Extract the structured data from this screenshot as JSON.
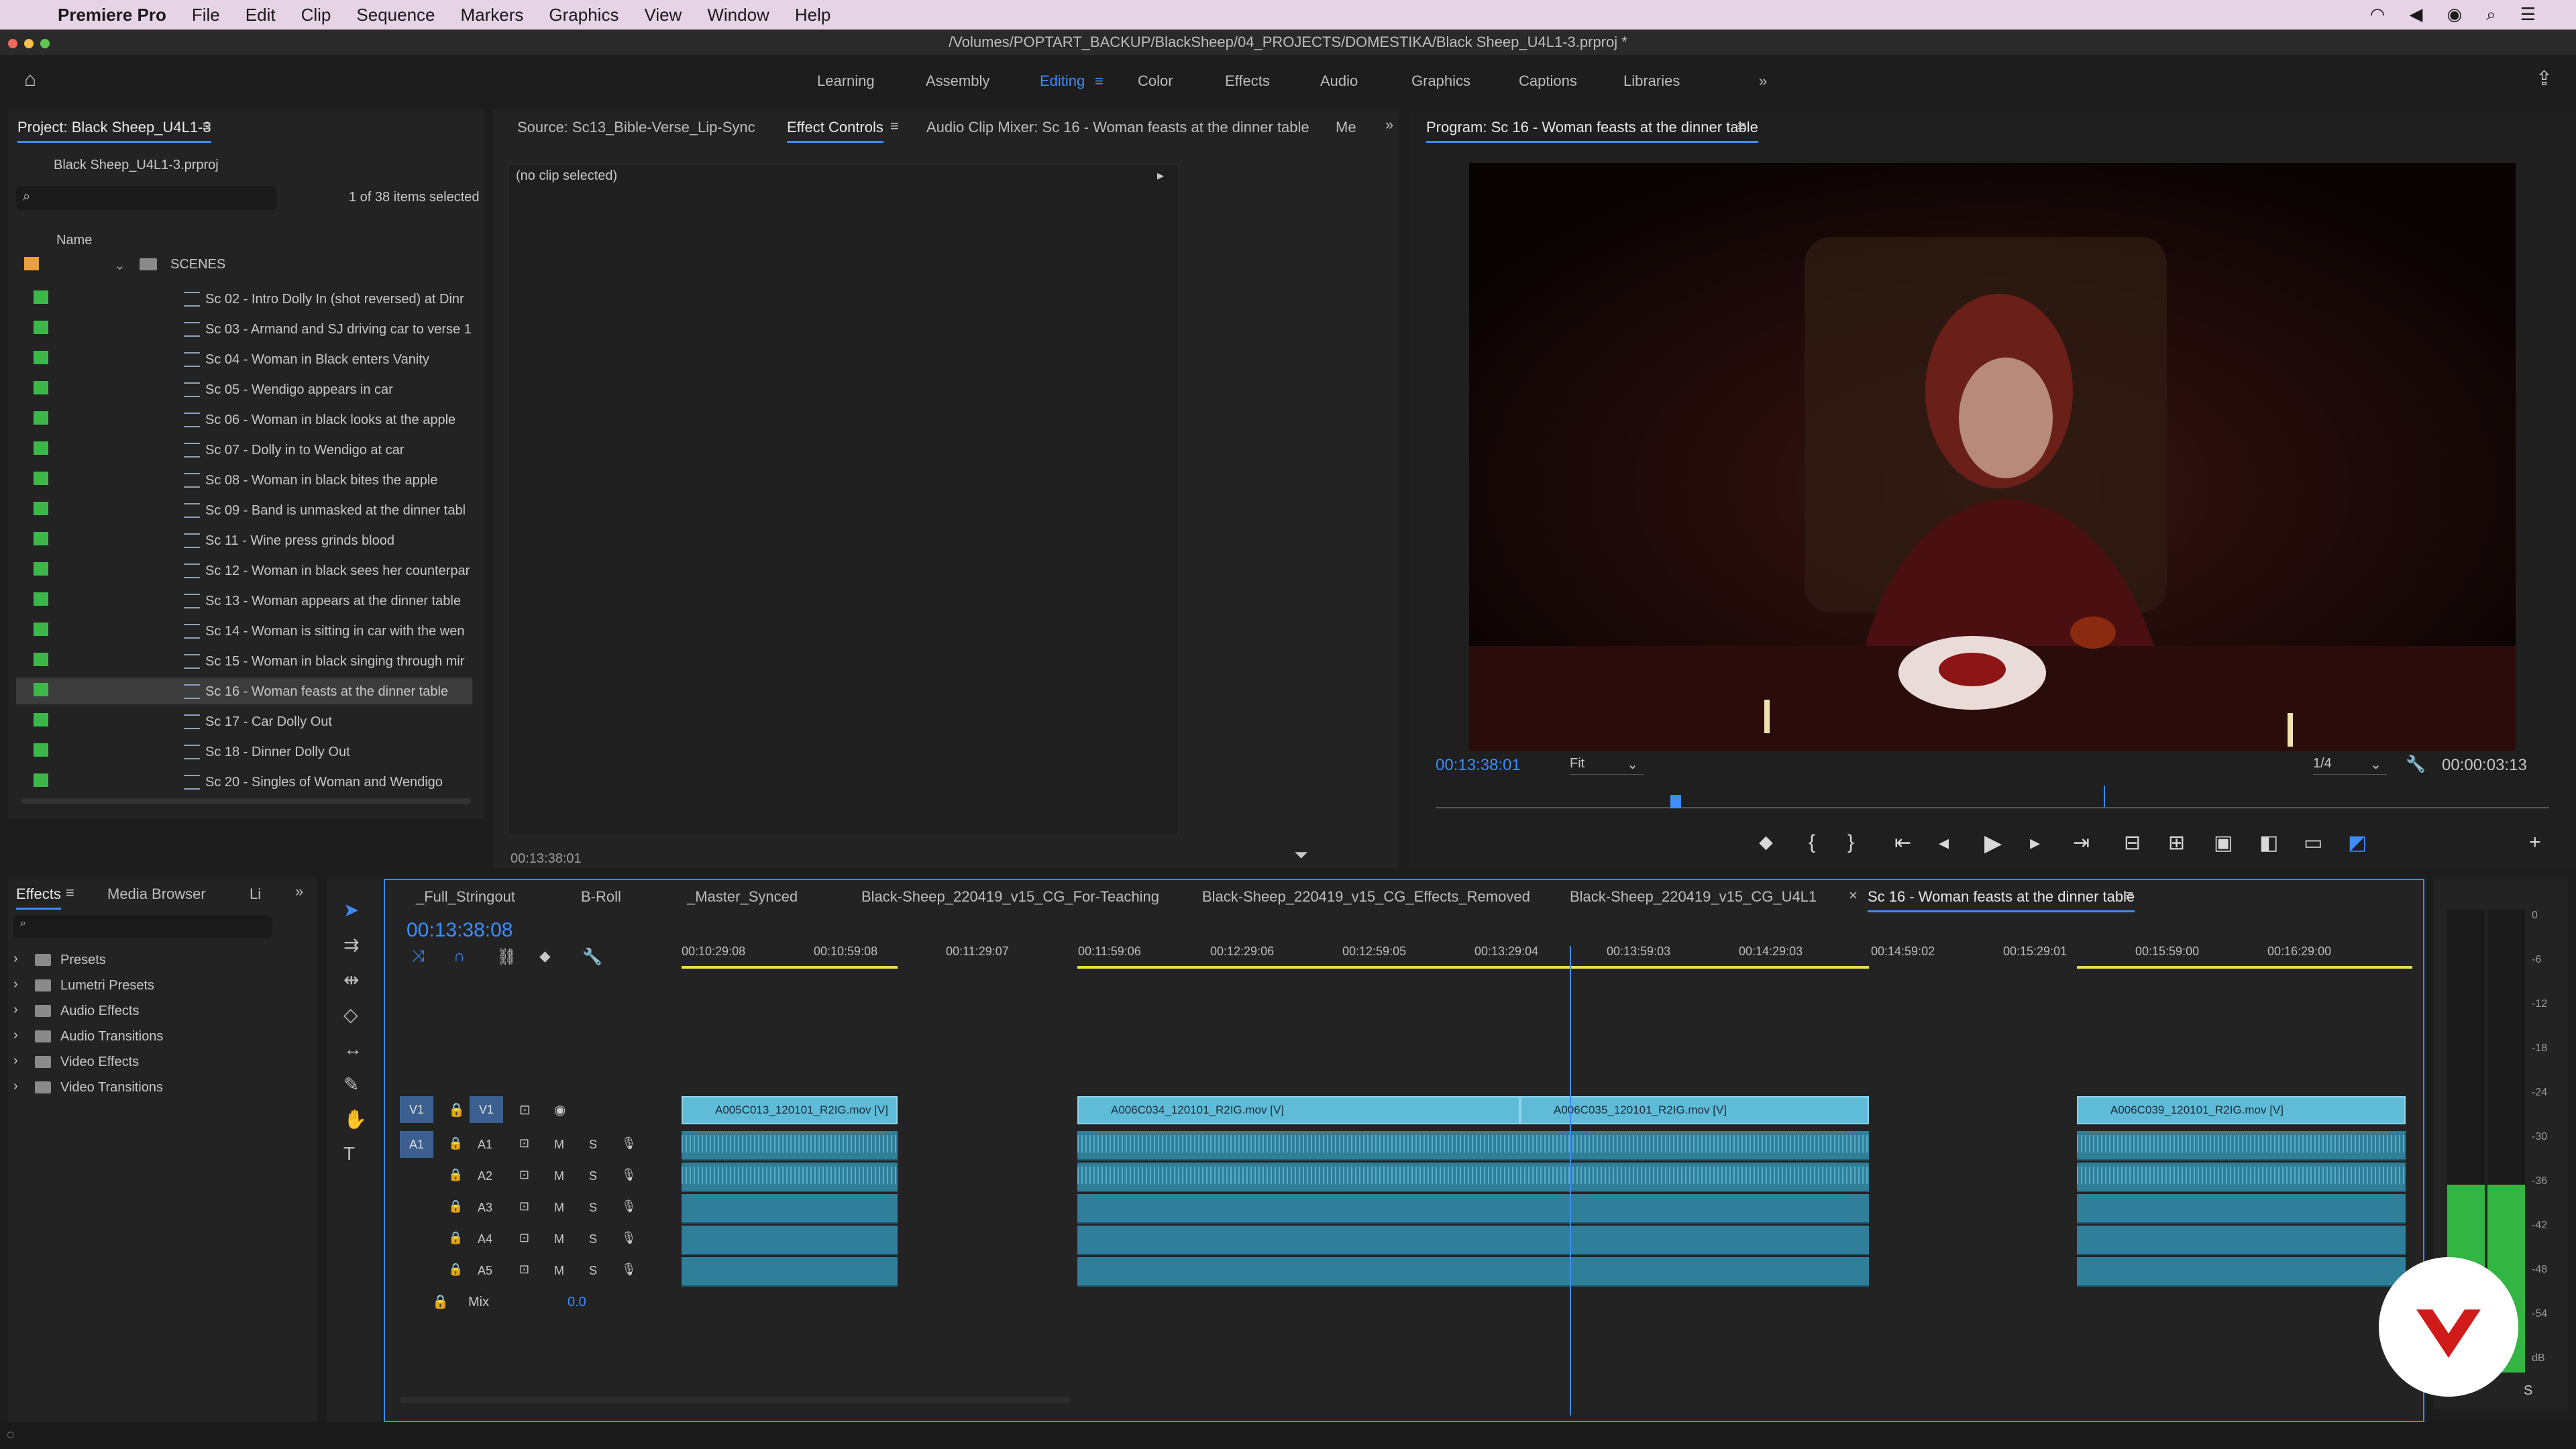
{
  "menubar": {
    "app_name": "Premiere Pro",
    "items": [
      "File",
      "Edit",
      "Clip",
      "Sequence",
      "Markers",
      "Graphics",
      "View",
      "Window",
      "Help"
    ]
  },
  "window": {
    "title": "/Volumes/POPTART_BACKUP/BlackSheep/04_PROJECTS/DOMESTIKA/Black Sheep_U4L1-3.prproj *"
  },
  "workspaces": [
    "Learning",
    "Assembly",
    "Editing",
    "Color",
    "Effects",
    "Audio",
    "Graphics",
    "Captions",
    "Libraries"
  ],
  "active_workspace": "Editing",
  "project": {
    "tab": "Project: Black Sheep_U4L1-3",
    "file": "Black Sheep_U4L1-3.prproj",
    "selection": "1 of 38 items selected",
    "column_name": "Name",
    "folder": "SCENES",
    "items": [
      "Sc 02 - Intro Dolly In (shot reversed) at Dinr",
      "Sc 03 - Armand and SJ driving car to verse 1",
      "Sc 04 - Woman in Black enters Vanity",
      "Sc 05 - Wendigo appears in car",
      "Sc 06 - Woman in black looks at the apple",
      "Sc 07 - Dolly in to Wendigo at car",
      "Sc 08 - Woman in black bites the apple",
      "Sc 09 - Band is unmasked at the dinner tabl",
      "Sc 11 - Wine press grinds blood",
      "Sc 12 - Woman in black sees her counterpar",
      "Sc 13 - Woman appears at the dinner table",
      "Sc 14 - Woman is sitting in car with the wen",
      "Sc 15 - Woman in black singing through mir",
      "Sc 16 - Woman feasts at the dinner table",
      "Sc 17 - Car Dolly Out",
      "Sc 18 - Dinner Dolly Out",
      "Sc 20 - Singles of Woman and Wendigo"
    ]
  },
  "source_panel": {
    "tabs": [
      "Source: Sc13_Bible-Verse_Lip-Sync",
      "Effect Controls",
      "Audio Clip Mixer: Sc 16 - Woman feasts at the dinner table",
      "Me"
    ],
    "no_clip": "(no clip selected)",
    "timecode": "00:13:38:01"
  },
  "program": {
    "tab": "Program: Sc 16 - Woman feasts at the dinner table",
    "timecode": "00:13:38:01",
    "fit": "Fit",
    "quality": "1/4",
    "duration": "00:00:03:13"
  },
  "effects": {
    "tabs": [
      "Effects",
      "Media Browser",
      "Li"
    ],
    "folders": [
      "Presets",
      "Lumetri Presets",
      "Audio Effects",
      "Audio Transitions",
      "Video Effects",
      "Video Transitions"
    ]
  },
  "timeline": {
    "tabs": [
      "_Full_Stringout",
      "B-Roll",
      "_Master_Synced",
      "Black-Sheep_220419_v15_CG_For-Teaching",
      "Black-Sheep_220419_v15_CG_Effects_Removed",
      "Black-Sheep_220419_v15_CG_U4L1",
      "Sc 16 - Woman feasts at the dinner table"
    ],
    "playhead": "00:13:38:08",
    "ruler": [
      "00:10:29:08",
      "00:10:59:08",
      "00:11:29:07",
      "00:11:59:06",
      "00:12:29:06",
      "00:12:59:05",
      "00:13:29:04",
      "00:13:59:03",
      "00:14:29:03",
      "00:14:59:02",
      "00:15:29:01",
      "00:15:59:00",
      "00:16:29:00"
    ],
    "tracks": {
      "v1": "V1",
      "a": [
        "A1",
        "A2",
        "A3",
        "A4",
        "A5"
      ],
      "m": "M",
      "s": "S",
      "mix": "Mix",
      "mix_value": "0.0"
    },
    "clips": [
      "A005C013_120101_R2IG.mov [V]",
      "A006C034_120101_R2IG.mov [V]",
      "A006C035_120101_R2IG.mov [V]",
      "A006C039_120101_R2IG.mov [V]"
    ]
  },
  "meter": {
    "scale": [
      "0",
      "-6",
      "-12",
      "-18",
      "-24",
      "-30",
      "-36",
      "-42",
      "-48",
      "-54",
      "dB"
    ],
    "solo": "S"
  },
  "colors": {
    "accent": "#3d8dff",
    "label_green": "#3cb84a",
    "video_clip": "#5fbcd8",
    "audio_clip": "#2f7f9a",
    "brand_logo": "#d11a1a"
  }
}
